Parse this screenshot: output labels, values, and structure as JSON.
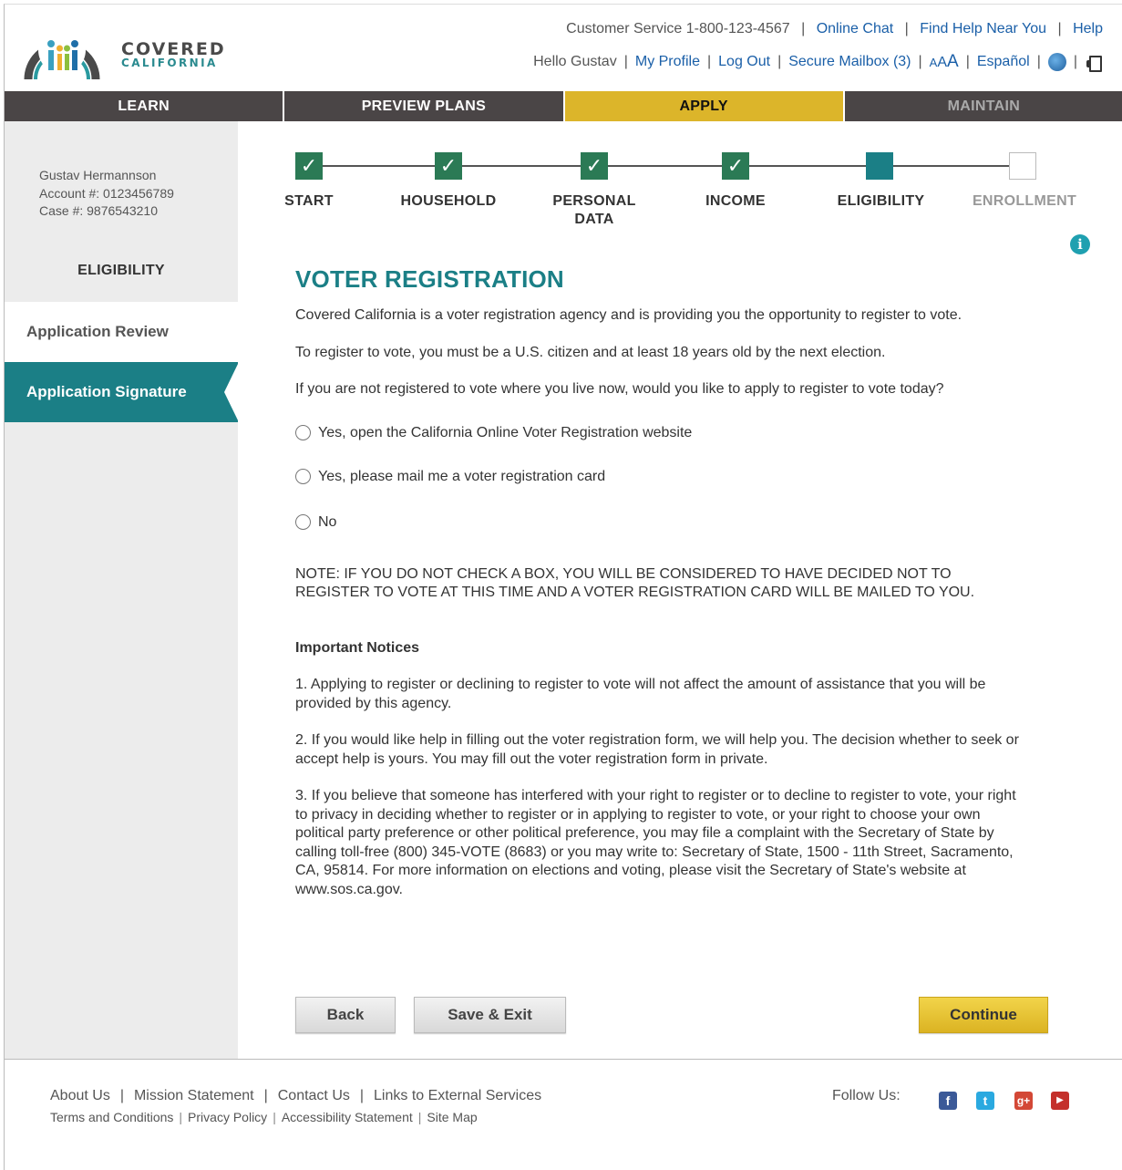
{
  "brand": {
    "line1": "COVERED",
    "line2": "CALIFORNIA"
  },
  "utility": {
    "customer_service": "Customer Service 1-800-123-4567",
    "online_chat": "Online Chat",
    "find_help": "Find Help Near You",
    "help": "Help",
    "hello": "Hello Gustav",
    "my_profile": "My Profile",
    "log_out": "Log Out",
    "secure_mailbox": "Secure Mailbox (3)",
    "text_size": [
      "A",
      "A",
      "A"
    ],
    "language": "Español"
  },
  "nav": [
    {
      "label": "LEARN",
      "active": false
    },
    {
      "label": "PREVIEW PLANS",
      "active": false
    },
    {
      "label": "APPLY",
      "active": true
    },
    {
      "label": "MAINTAIN",
      "active": false
    }
  ],
  "account": {
    "name": "Gustav Hermannson",
    "account_line": "Account #: 0123456789",
    "case_line": "Case #: 9876543210"
  },
  "sidebar": {
    "heading": "ELIGIBILITY",
    "items": [
      "Application Review",
      "Application Signature"
    ]
  },
  "steps": [
    {
      "label": "START",
      "status": "complete"
    },
    {
      "label": "HOUSEHOLD",
      "status": "complete"
    },
    {
      "label": "PERSONAL DATA",
      "status": "complete"
    },
    {
      "label": "INCOME",
      "status": "complete"
    },
    {
      "label": "ELIGIBILITY",
      "status": "current"
    },
    {
      "label": "ENROLLMENT",
      "status": "future"
    }
  ],
  "content": {
    "title": "VOTER REGISTRATION",
    "p1": "Covered California is a voter registration agency and is providing you the opportunity to register to vote.",
    "p2": "To register to vote, you must be a U.S. citizen and at least 18 years old by the next election.",
    "p3": "If you are not registered to vote where you live now, would you like to apply to register to vote today?",
    "options": [
      "Yes, open the California Online Voter Registration website",
      "Yes, please mail me a voter registration card",
      "No"
    ],
    "note": "NOTE: IF YOU DO NOT CHECK A BOX, YOU WILL BE CONSIDERED TO HAVE DECIDED NOT TO REGISTER TO VOTE AT THIS TIME AND A VOTER REGISTRATION CARD WILL BE MAILED TO YOU.",
    "notices_heading": "Important Notices",
    "notice1": "1. Applying to register or declining to register to vote will not affect the amount of assistance that you will be provided by this agency.",
    "notice2": "2. If you would like help in filling out the voter registration form, we will help you. The decision whether to seek or accept help is yours. You may fill out the voter registration form in private.",
    "notice3": "3. If you believe that someone has interfered with your right to register or to decline to register to vote, your right to privacy in deciding whether to register or in applying to register to vote, or your right to choose your own political party preference or other political preference, you may file a complaint with the Secretary of State by calling toll-free (800) 345-VOTE (8683) or you may write to: Secretary of State, 1500 - 11th Street, Sacramento, CA, 95814. For more information on elections and voting, please visit the Secretary of State's website at www.sos.ca.gov."
  },
  "buttons": {
    "back": "Back",
    "save_exit": "Save & Exit",
    "continue": "Continue"
  },
  "footer": {
    "row1": [
      "About Us",
      "Mission Statement",
      "Contact Us",
      "Links to External Services"
    ],
    "row2": [
      "Terms and Conditions",
      "Privacy Policy",
      "Accessibility Statement",
      "Site Map"
    ],
    "follow": "Follow Us:",
    "social": [
      {
        "icon": "facebook-icon",
        "glyph": "f",
        "color": "#3b5998"
      },
      {
        "icon": "twitter-icon",
        "glyph": "t",
        "color": "#2aa9e0"
      },
      {
        "icon": "google-plus-icon",
        "glyph": "g+",
        "color": "#d34836"
      },
      {
        "icon": "youtube-icon",
        "glyph": "▶",
        "color": "#c4302b"
      }
    ]
  },
  "colors": {
    "teal": "#1b7f86",
    "gold": "#dcb52a",
    "nav_dark": "#4a4546",
    "step_done": "#2b7a55"
  }
}
